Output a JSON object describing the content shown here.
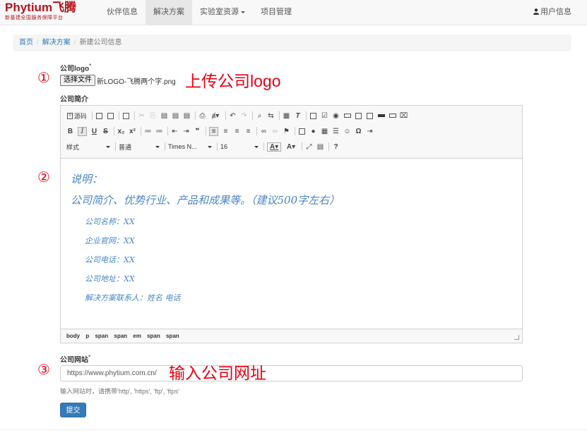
{
  "navbar": {
    "brand": {
      "latin": "Phytium",
      "cjk": "飞腾",
      "tagline": "新基建全国服务保障平台"
    },
    "items": [
      {
        "label": "伙伴信息"
      },
      {
        "label": "解决方案",
        "active": true
      },
      {
        "label": "实验室资源"
      },
      {
        "label": "项目管理"
      }
    ],
    "user_label": "用户信息"
  },
  "breadcrumb": {
    "home": "首页",
    "section": "解决方案",
    "current": "新建公司信息"
  },
  "logo_field": {
    "label": "公司logo",
    "required_mark": "*",
    "button": "选择文件",
    "filename": "新LOGO-飞腾两个字.png",
    "annotation": "上传公司logo",
    "marker": "①"
  },
  "intro_field": {
    "label": "公司简介",
    "marker": "②",
    "toolbar": {
      "source_label": "源码",
      "style_combo": "样式",
      "format_combo": "普通",
      "font_combo": "Times N...",
      "size_combo": "16"
    },
    "content": {
      "heading": "说明：",
      "summary": "公司简介、优势行业、产品和成果等。（建议500字左右）",
      "lines": [
        "公司名称：XX",
        "企业官网：XX",
        "公司电话：XX",
        "公司地址：XX",
        "解决方案联系人：姓名  电话"
      ]
    },
    "path": [
      "body",
      "p",
      "span",
      "span",
      "em",
      "span",
      "span"
    ]
  },
  "website_field": {
    "label": "公司网站",
    "required_mark": "*",
    "value": "https://www.phytium.com.cn/",
    "annotation": "输入公司网址",
    "marker": "③",
    "help": "输入网站时，请携带'http', 'https', 'ftp', 'ftps'"
  },
  "submit_label": "提交",
  "colors": {
    "brand_red": "#e60012",
    "link": "#337ab7",
    "editor_text": "#4a86c5",
    "primary": "#337ab7"
  }
}
